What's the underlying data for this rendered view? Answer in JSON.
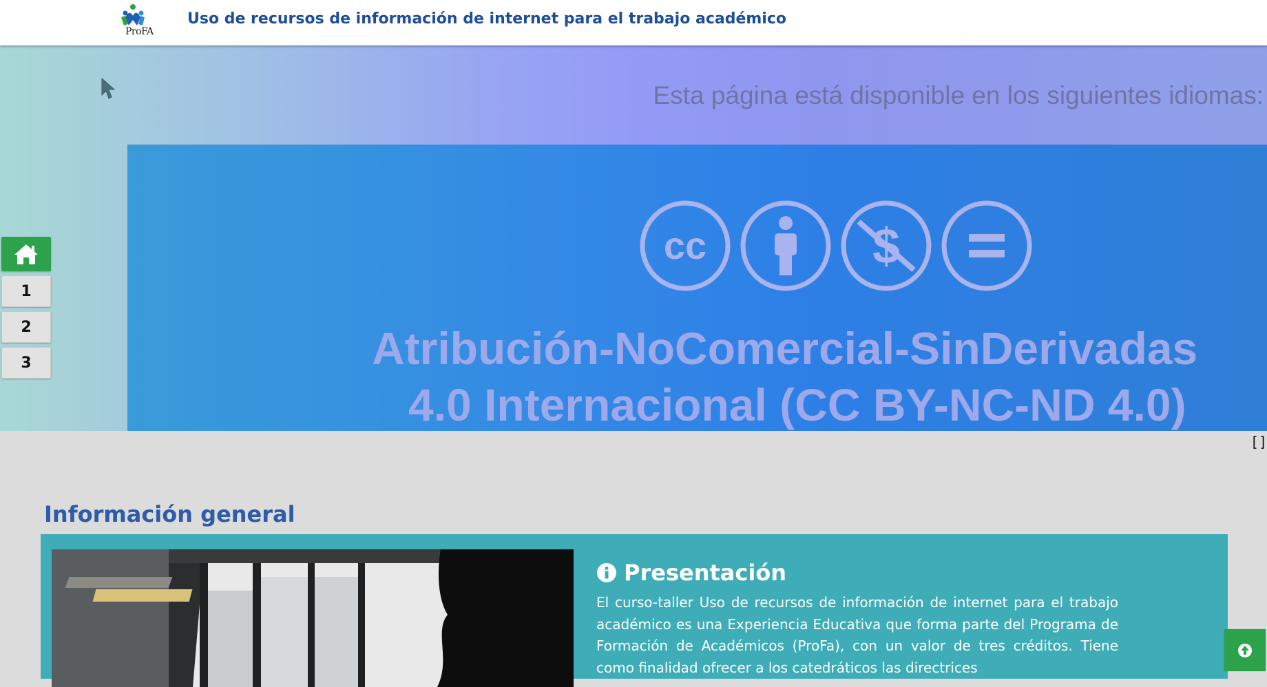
{
  "header": {
    "logo_text": "ProFA",
    "title": "Uso de recursos de información de internet para el trabajo académico"
  },
  "hero": {
    "availability_text": "Esta página está disponible en los siguientes idiomas:",
    "license_line1": "Atribución-NoComercial-SinDerivadas",
    "license_line2": "4.0 Internacional (CC BY-NC-ND 4.0)",
    "license_icons": [
      "cc-icon",
      "attribution-icon",
      "noncommercial-icon",
      "noderivatives-icon"
    ]
  },
  "sidenav": {
    "home_icon": "home-icon",
    "items": [
      "1",
      "2",
      "3"
    ]
  },
  "bracket_text": "[]",
  "info": {
    "section_title": "Información general",
    "presentation_title": "Presentación",
    "presentation_icon": "info-icon",
    "presentation_text": "El curso-taller Uso de recursos de información de internet para el trabajo académico es una Experiencia Educativa que forma parte del Programa de Formación de Académicos (ProFa), con un valor de tres créditos. Tiene como finalidad ofrecer a los catedráticos las directrices"
  },
  "back_to_top_icon": "arrow-up-circle-icon",
  "colors": {
    "header_title": "#1f4e99",
    "nav_home": "#2ca24a",
    "info_box": "#3fadb8",
    "section_title": "#2e5ca8"
  }
}
